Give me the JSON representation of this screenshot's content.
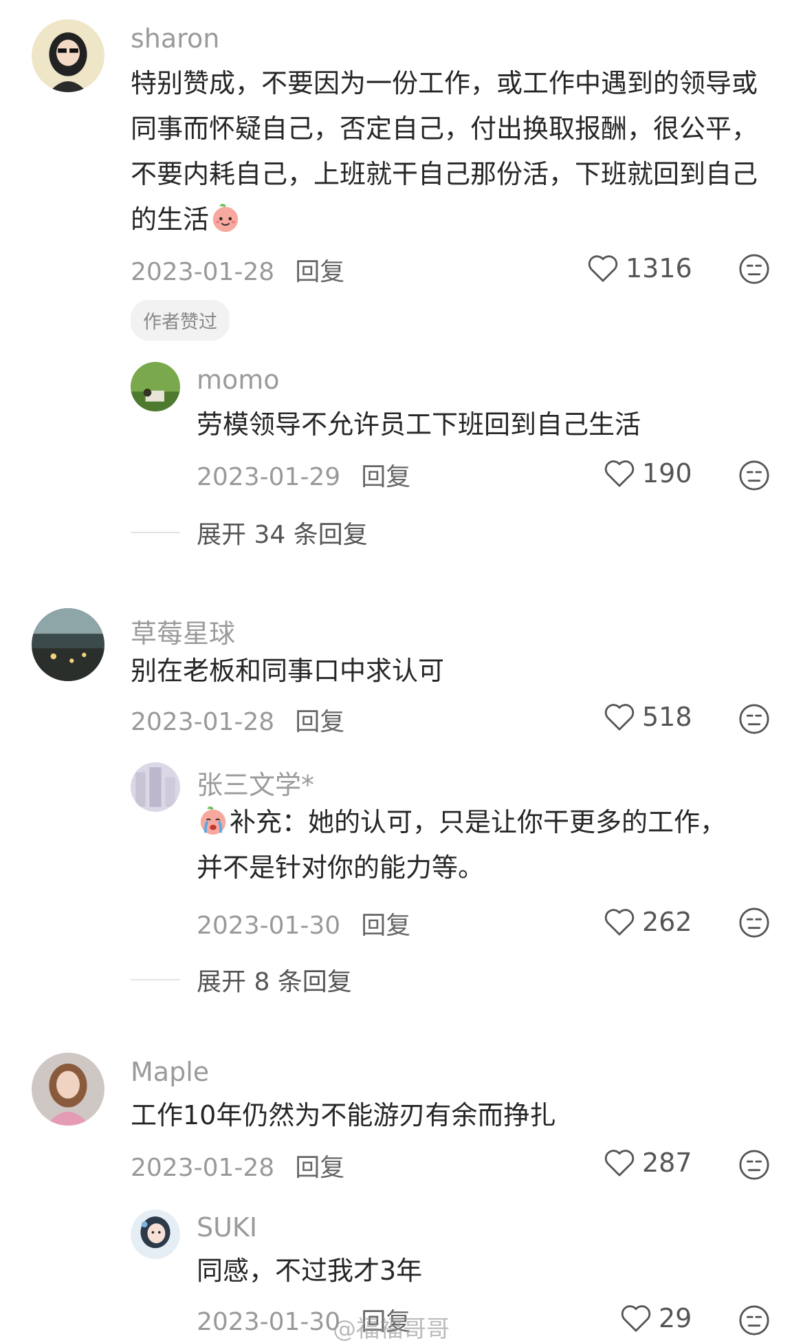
{
  "comments": [
    {
      "username": "sharon",
      "text": "特别赞成，不要因为一份工作，或工作中遇到的领导或同事而怀疑自己，否定自己，付出换取报酬，很公平，不要内耗自己，上班就干自己那份活，下班就回到自己的生活",
      "emoji": "smiling-peach-emoji",
      "date": "2023-01-28",
      "reply_label": "回复",
      "likes": "1316",
      "badge": "作者赞过",
      "replies": [
        {
          "username": "momo",
          "text": "劳模领导不允许员工下班回到自己生活",
          "date": "2023-01-29",
          "reply_label": "回复",
          "likes": "190"
        }
      ],
      "expand_label": "展开 34 条回复"
    },
    {
      "username": "草莓星球",
      "text": "别在老板和同事口中求认可",
      "date": "2023-01-28",
      "reply_label": "回复",
      "likes": "518",
      "replies": [
        {
          "username": "张三文学*",
          "emoji": "crying-peach-emoji",
          "text": "补充：她的认可，只是让你干更多的工作，并不是针对你的能力等。",
          "date": "2023-01-30",
          "reply_label": "回复",
          "likes": "262"
        }
      ],
      "expand_label": "展开 8 条回复"
    },
    {
      "username": "Maple",
      "text": "工作10年仍然为不能游刃有余而挣扎",
      "date": "2023-01-28",
      "reply_label": "回复",
      "likes": "287",
      "replies": [
        {
          "username": "SUKI",
          "text": "同感，不过我才3年",
          "date": "2023-01-30",
          "reply_label": "回复",
          "likes": "29"
        }
      ]
    }
  ],
  "watermark": "@福福哥哥",
  "icons": {
    "like": "heart-outline-icon",
    "dislike": "meh-face-icon"
  },
  "colors": {
    "username": "#9a9a9a",
    "meta": "#999999",
    "body": "#262626"
  }
}
